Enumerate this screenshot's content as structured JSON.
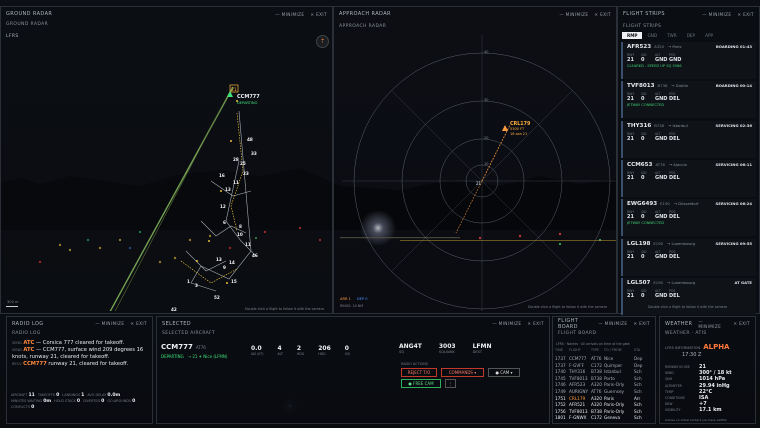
{
  "ground": {
    "title": "GROUND RADAR",
    "sub": "GROUND RADAR",
    "minimize": "— MINIMIZE",
    "exit": "✕ EXIT",
    "airport": "LFRS",
    "scale": "300 m",
    "hint": "Double click a flight to follow it with the camera"
  },
  "ground_tag": {
    "callsign": "CCM777",
    "sub": "DEPARTING",
    "rwy": "21"
  },
  "taxi_labels": [
    "48",
    "33",
    "28",
    "25",
    "23",
    "11",
    "16",
    "13",
    "12",
    "6",
    "8",
    "10",
    "11",
    "46",
    "13",
    "14",
    "9",
    "15",
    "1",
    "3",
    "52",
    "42"
  ],
  "approach": {
    "title": "APPROACH RADAR",
    "sub": "APPROACH RADAR",
    "minimize": "— MINIMIZE",
    "exit": "✕ EXIT",
    "hint": "Double click a flight to follow it with the camera",
    "legend_arr": "ARR 1",
    "legend_dep": "DEP 0",
    "legend_rng": "RINGS: 10 NM",
    "rwy": "21",
    "rings": [
      "10",
      "20",
      "30",
      "40"
    ],
    "target": {
      "callsign": "CRL179",
      "alt": "5300 FT",
      "spd": "16 sea 21"
    }
  },
  "strips": {
    "title": "FLIGHT STRIPS",
    "sub": "FLIGHT STRIPS",
    "minimize": "— MINIMIZE",
    "exit": "✕ EXIT",
    "tabs": [
      "RMP",
      "GND",
      "TWR",
      "DEP",
      "APP"
    ],
    "hint": "Double click a flight to follow it with the camera",
    "col_labels": [
      "RWY",
      "SID",
      "ALT",
      "POS"
    ],
    "items": [
      {
        "cs": "AFR523",
        "ty": "A320",
        "rt": "→ Paris",
        "st": "BOARDING 01:43",
        "v": [
          "21",
          "0",
          "GND",
          "GND"
        ],
        "note": "CLEARED - SPEED UP  SQ 5566"
      },
      {
        "cs": "TVF8013",
        "ty": "B738",
        "rt": "→ Dublin",
        "st": "BOARDING 00:14",
        "v": [
          "21",
          "0",
          "GND",
          "DEL"
        ],
        "note": "JETWAY CONNECTED"
      },
      {
        "cs": "THY316",
        "ty": "B738",
        "rt": "→ Istanbul",
        "st": "SERVICING 02:36",
        "v": [
          "21",
          "0",
          "GND",
          "DEL"
        ],
        "note": ""
      },
      {
        "cs": "CCM653",
        "ty": "AT76",
        "rt": "→ Ajaccio",
        "st": "SERVICING 06:11",
        "v": [
          "21",
          "0",
          "GND",
          "DEL"
        ],
        "note": ""
      },
      {
        "cs": "EWG6493",
        "ty": "E190",
        "rt": "→ Düsseldorf",
        "st": "SERVICING 06:24",
        "v": [
          "21",
          "0",
          "GND",
          "DEL"
        ],
        "note": "JETWAY CONNECTED"
      },
      {
        "cs": "LGL198",
        "ty": "E190",
        "rt": "→ Luxembourg",
        "st": "SERVICING 09:55",
        "v": [
          "21",
          "0",
          "GND",
          "DEL"
        ],
        "note": ""
      },
      {
        "cs": "LGL507",
        "ty": "E190",
        "rt": "→ Luxembourg",
        "st": "AT GATE",
        "v": [
          "21",
          "0",
          "GND",
          "DEL"
        ],
        "note": ""
      }
    ]
  },
  "radio": {
    "title": "RADIO LOG",
    "sub": "RADIO LOG",
    "minimize": "— MINIMIZE",
    "exit": "✕ EXIT",
    "lines": [
      {
        "tag": "SEND",
        "who": "ATC",
        "text": "— Corsica 777 cleared for takeoff."
      },
      {
        "tag": "SEND",
        "who": "ATC",
        "text": "— CCM777, surface wind 209 degrees 16 knots, runway 21, cleared for takeoff."
      },
      {
        "tag": "RECV",
        "who": "CCM777",
        "text": "runway 21, cleared for takeoff."
      }
    ],
    "stats": [
      [
        "AIRCRAFT",
        "11"
      ],
      [
        "TAKEOFFS",
        "0"
      ],
      [
        "LANDINGS",
        "1"
      ],
      [
        "AVG DELAY",
        "0.0m"
      ],
      [
        "MINUTES WAITING",
        "0m"
      ],
      [
        "HOLD STACK",
        "0"
      ],
      [
        "DIVERTED",
        "0"
      ],
      [
        "GO-AROUNDS",
        "0"
      ],
      [
        "CONFLICTS",
        "0"
      ]
    ]
  },
  "selected": {
    "title": "SELECTED",
    "sub": "SELECTED AIRCRAFT",
    "minimize": "— MINIMIZE",
    "exit": "✕ EXIT",
    "cs": "CCM777",
    "ty": "AT76",
    "status": "DEPARTING",
    "route": "→ 21  ✈ Nice (LFMN)",
    "kpis": [
      [
        "0.0",
        "IAS (KT)"
      ],
      [
        "4",
        "ALT"
      ],
      [
        "2",
        "HDG"
      ],
      [
        "206",
        "HDG"
      ],
      [
        "0",
        "V/S"
      ]
    ],
    "sq": "ANG4T",
    "sq_l": "SQ",
    "alt2": "3003",
    "alt2_l": "SQUAWK",
    "dest": "LFMN",
    "dest_l": "DEST",
    "actions_l": "RADIO ACTIONS",
    "reject": "REJECT T/O",
    "commands": "COMMANDS ▾",
    "cam": "● CAM ▾",
    "freecam": "● FREE CAM",
    "more": "⋮"
  },
  "board": {
    "title": "FLIGHT BOARD",
    "sub": "FLIGHT BOARD",
    "minimize": "— MINIMIZE",
    "exit": "✕ EXIT",
    "head": "LFRS · Nantes · All arrivals on time at the gate",
    "cols": [
      "TIME",
      "FLIGHT",
      "TYPE",
      "TO / FROM",
      "STA"
    ],
    "rows": [
      [
        "1737",
        "CCM777",
        "AT76",
        "Nice",
        "Dep"
      ],
      [
        "1737",
        "F-GVFF",
        "C172",
        "Quimper",
        "Dep"
      ],
      [
        "1740",
        "THY316",
        "B738",
        "Istanbul",
        "Sch"
      ],
      [
        "1745",
        "TVF8013",
        "B738",
        "Porto",
        "Sch"
      ],
      [
        "1746",
        "AFR523",
        "A320",
        "Paris-Orly",
        "Sch"
      ],
      [
        "1749",
        "AURIGNY",
        "AT76",
        "Guernsey",
        "Sch"
      ],
      [
        "1751",
        "CRL179",
        "A320",
        "Paris",
        "Arr"
      ],
      [
        "1752",
        "AFR521",
        "A320",
        "Paris-Orly",
        "Sch"
      ],
      [
        "1756",
        "TVF8013",
        "B738",
        "Paris-Orly",
        "Sch"
      ],
      [
        "1801",
        "F-GNWX",
        "C172",
        "Geneva",
        "Sch"
      ]
    ]
  },
  "weather": {
    "title": "WEATHER",
    "sub": "WEATHER · ATIS",
    "minimize": "— MINIMIZE",
    "exit": "✕ EXIT",
    "atis_l": "LFRS INFORMATION",
    "atis": "ALPHA",
    "time": "17:30 Z",
    "items": [
      [
        "RUNWAY IN USE",
        "21"
      ],
      [
        "WIND",
        "300° / 18 kt"
      ],
      [
        "QNH",
        "1014 hPa"
      ],
      [
        "ALTIMETER",
        "29.94 inHg"
      ],
      [
        "TEMP",
        "22°C"
      ],
      [
        "CONDITIONS",
        "ISA"
      ],
      [
        "DEW",
        "+7"
      ],
      [
        "VISIBILITY",
        "17.1 km"
      ]
    ],
    "foot": "Advise on initial contact you have ALPHA"
  }
}
